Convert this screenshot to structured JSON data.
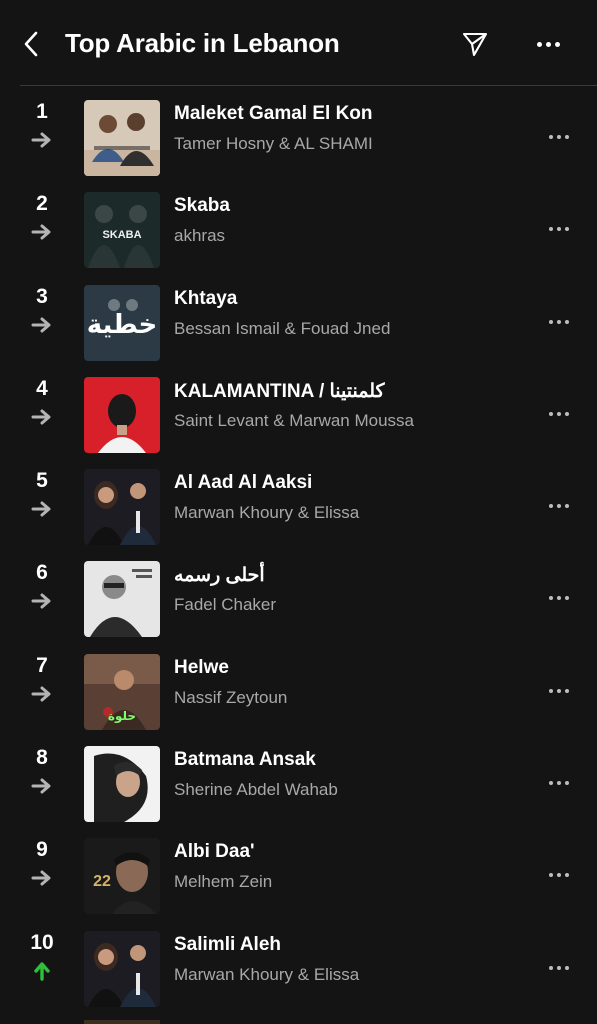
{
  "header": {
    "title": "Top Arabic in Lebanon",
    "back_icon": "chevron-left-icon",
    "share_icon": "paper-plane-icon",
    "more_icon": "more-horizontal-icon"
  },
  "colors": {
    "background": "#141414",
    "secondary_text": "#a8a8a8",
    "up_trend": "#2fbf3a",
    "neutral_trend": "#b4b4b4"
  },
  "tracks": [
    {
      "rank": "1",
      "title": "Maleket Gamal El Kon",
      "artist": "Tamer Hosny & AL SHAMI",
      "trend": "same"
    },
    {
      "rank": "2",
      "title": "Skaba",
      "artist": "akhras",
      "trend": "same"
    },
    {
      "rank": "3",
      "title": "Khtaya",
      "artist": "Bessan Ismail & Fouad Jned",
      "trend": "same"
    },
    {
      "rank": "4",
      "title": "KALAMANTINA / كلمنتينا",
      "artist": "Saint Levant & Marwan Moussa",
      "trend": "same"
    },
    {
      "rank": "5",
      "title": "Al Aad Al Aaksi",
      "artist": "Marwan Khoury & Elissa",
      "trend": "same"
    },
    {
      "rank": "6",
      "title": "أحلى رسمه",
      "artist": "Fadel Chaker",
      "trend": "same"
    },
    {
      "rank": "7",
      "title": "Helwe",
      "artist": "Nassif Zeytoun",
      "trend": "same"
    },
    {
      "rank": "8",
      "title": "Batmana Ansak",
      "artist": "Sherine Abdel Wahab",
      "trend": "same"
    },
    {
      "rank": "9",
      "title": "Albi Daa'",
      "artist": "Melhem Zein",
      "trend": "same"
    },
    {
      "rank": "10",
      "title": "Salimli Aleh",
      "artist": "Marwan Khoury & Elissa",
      "trend": "up"
    }
  ],
  "artwork_text": {
    "skaba": "SKABA",
    "khtaya": "خطية",
    "helwe": "حلوة",
    "albi": "22"
  }
}
